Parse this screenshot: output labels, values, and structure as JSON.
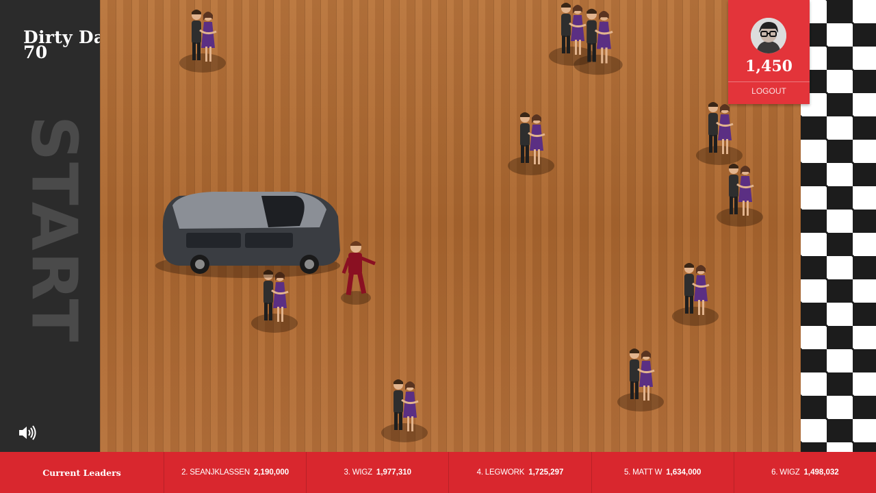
{
  "game": {
    "title": "Dirty Dancers",
    "level_score": "70",
    "start_label": "START"
  },
  "player": {
    "score": "1,450",
    "logout_label": "LOGOUT",
    "avatar_icon": "user-avatar-icon"
  },
  "controls": {
    "sound_icon": "speaker-volume-icon"
  },
  "leaders": {
    "title": "Current Leaders",
    "entries": [
      {
        "name": "2. SEANJKLASSEN",
        "score": "2,190,000"
      },
      {
        "name": "3. WIGZ",
        "score": "1,977,310"
      },
      {
        "name": "4. LEGWORK",
        "score": "1,725,297"
      },
      {
        "name": "5. MATT W",
        "score": "1,634,000"
      },
      {
        "name": "6. WIGZ",
        "score": "1,498,032"
      }
    ]
  },
  "colors": {
    "accent_red": "#d9272e",
    "panel_red": "#e3343a",
    "side_panel": "#2b2b2b",
    "floor_wood": "#b06c34"
  }
}
